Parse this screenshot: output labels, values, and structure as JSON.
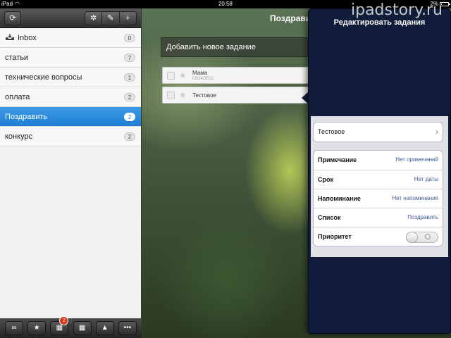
{
  "status_bar": {
    "device": "iPad",
    "time": "20:58",
    "battery": "2%"
  },
  "sidebar": {
    "items": [
      {
        "label": "Inbox",
        "count": "0"
      },
      {
        "label": "статьи",
        "count": "7"
      },
      {
        "label": "технические вопросы",
        "count": "1"
      },
      {
        "label": "оплата",
        "count": "2"
      },
      {
        "label": "Поздравить",
        "count": "2"
      },
      {
        "label": "конкурс",
        "count": "2"
      }
    ],
    "bottom_badge": "2"
  },
  "main": {
    "title": "Поздравить",
    "add_task_placeholder": "Добавить новое задание",
    "tasks": [
      {
        "title": "Мама",
        "date": "02/24/2012"
      },
      {
        "title": "Тестовое"
      }
    ]
  },
  "popover": {
    "title": "Редактировать задания",
    "task_name": "Тестовое",
    "rows": [
      {
        "label": "Примечание",
        "value": "Нет примечаний"
      },
      {
        "label": "Срок",
        "value": "Нет даты"
      },
      {
        "label": "Напоминание",
        "value": "Нет напоминания"
      },
      {
        "label": "Список",
        "value": "Поздравить"
      },
      {
        "label": "Приоритет"
      }
    ]
  },
  "watermark": "ipadstory.ru"
}
